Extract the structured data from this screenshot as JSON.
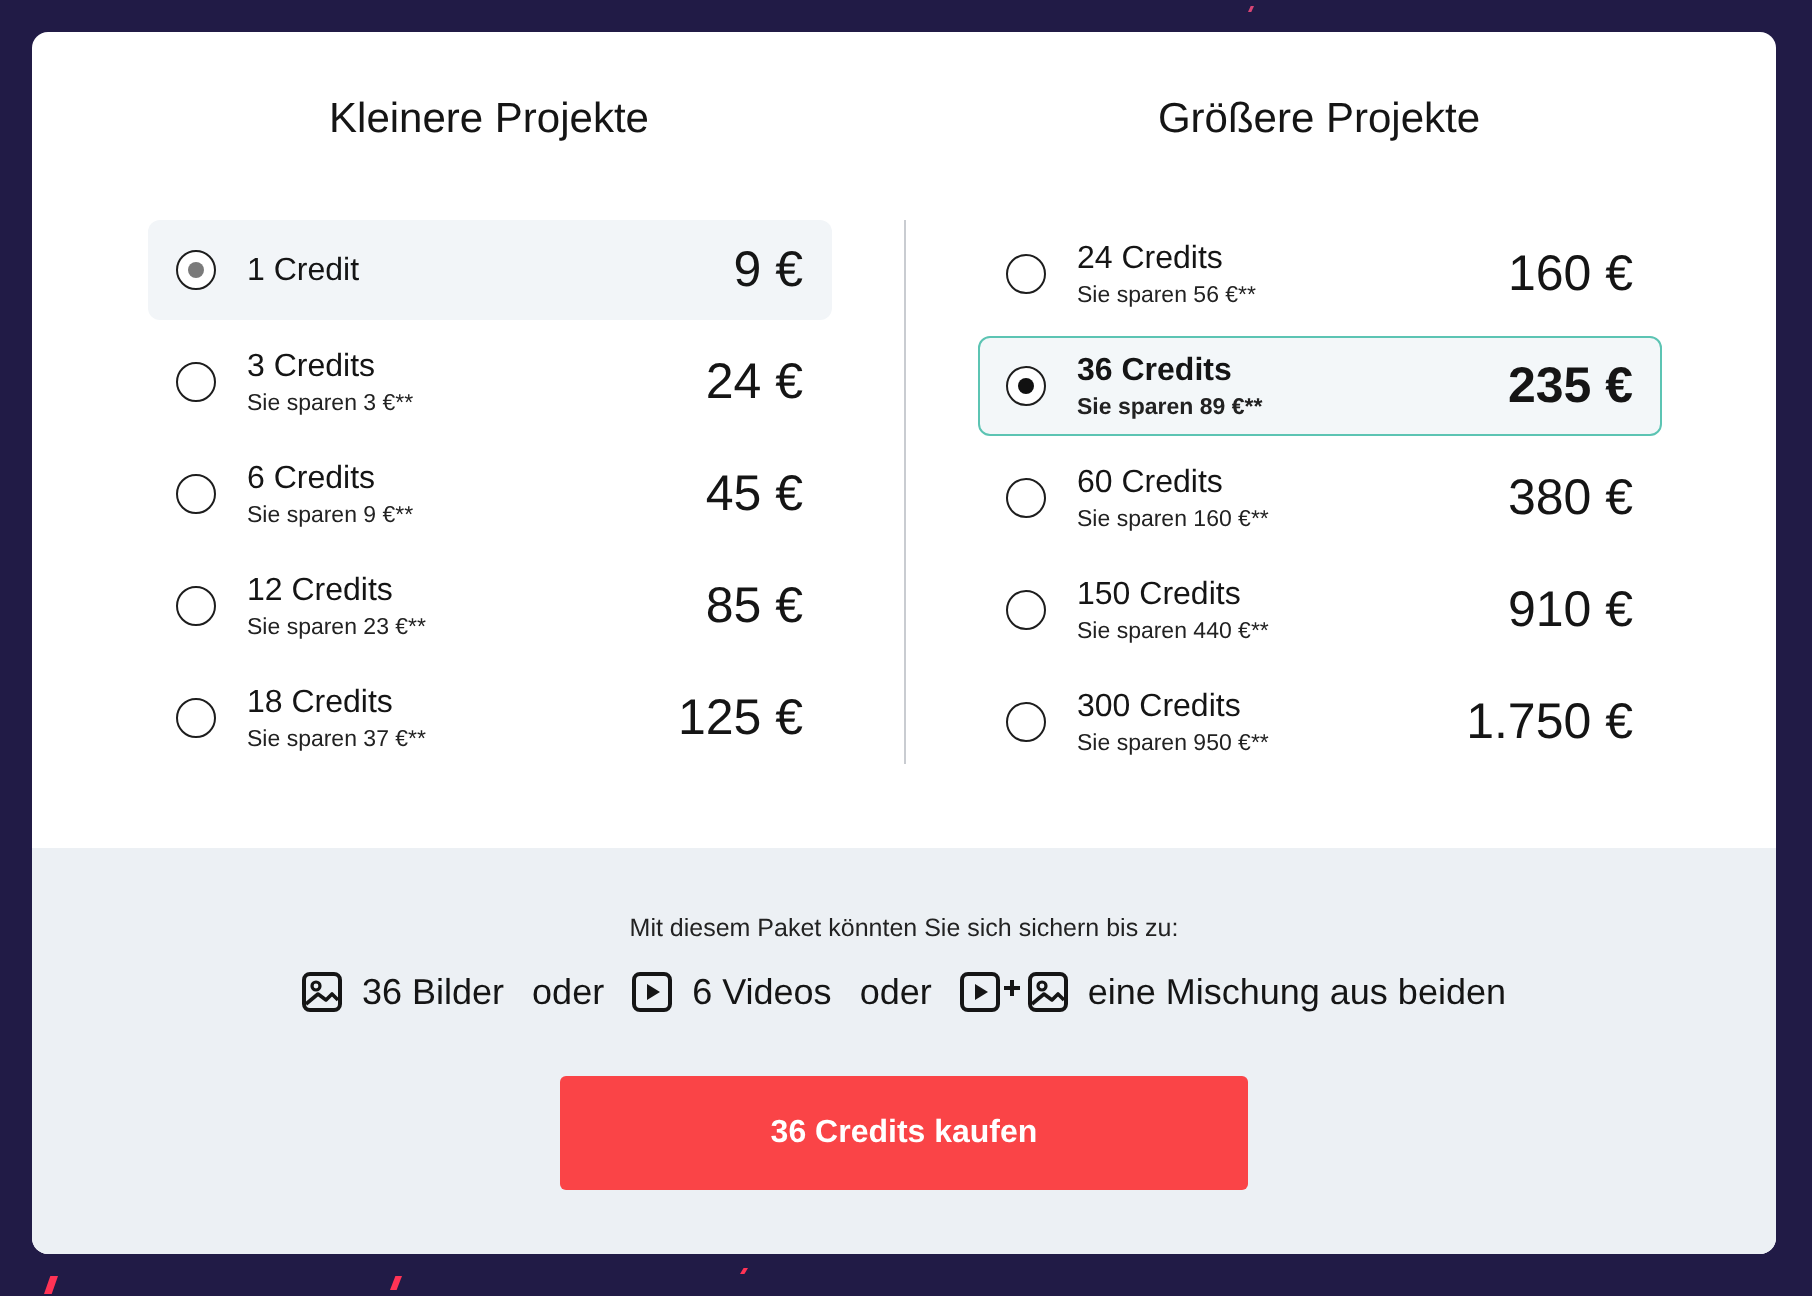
{
  "columns": [
    {
      "title": "Kleinere Projekte",
      "packages": [
        {
          "credits": "1 Credit",
          "price": "9 €",
          "selected": false,
          "hovered": true
        },
        {
          "credits": "3 Credits",
          "savings": "Sie sparen 3 €**",
          "price": "24 €",
          "selected": false,
          "hovered": false
        },
        {
          "credits": "6 Credits",
          "savings": "Sie sparen 9 €**",
          "price": "45 €",
          "selected": false,
          "hovered": false
        },
        {
          "credits": "12 Credits",
          "savings": "Sie sparen 23 €**",
          "price": "85 €",
          "selected": false,
          "hovered": false
        },
        {
          "credits": "18 Credits",
          "savings": "Sie sparen 37 €**",
          "price": "125 €",
          "selected": false,
          "hovered": false
        }
      ]
    },
    {
      "title": "Größere Projekte",
      "packages": [
        {
          "credits": "24 Credits",
          "savings": "Sie sparen 56 €**",
          "price": "160 €",
          "selected": false,
          "hovered": false
        },
        {
          "credits": "36 Credits",
          "savings": "Sie sparen 89 €**",
          "price": "235 €",
          "selected": true,
          "hovered": false
        },
        {
          "credits": "60 Credits",
          "savings": "Sie sparen 160 €**",
          "price": "380 €",
          "selected": false,
          "hovered": false
        },
        {
          "credits": "150 Credits",
          "savings": "Sie sparen 440 €**",
          "price": "910 €",
          "selected": false,
          "hovered": false
        },
        {
          "credits": "300 Credits",
          "savings": "Sie sparen 950 €**",
          "price": "1.750 €",
          "selected": false,
          "hovered": false
        }
      ]
    }
  ],
  "summary": {
    "intro": "Mit diesem Paket könnten Sie sich sichern bis zu:",
    "items": [
      {
        "kind": "images",
        "label": "36 Bilder"
      },
      {
        "kind": "conjunction",
        "label": "oder"
      },
      {
        "kind": "videos",
        "label": "6 Videos"
      },
      {
        "kind": "conjunction",
        "label": "oder"
      },
      {
        "kind": "mix",
        "label": "eine Mischung aus beiden"
      }
    ]
  },
  "buy_button": {
    "label": "36 Credits kaufen"
  }
}
